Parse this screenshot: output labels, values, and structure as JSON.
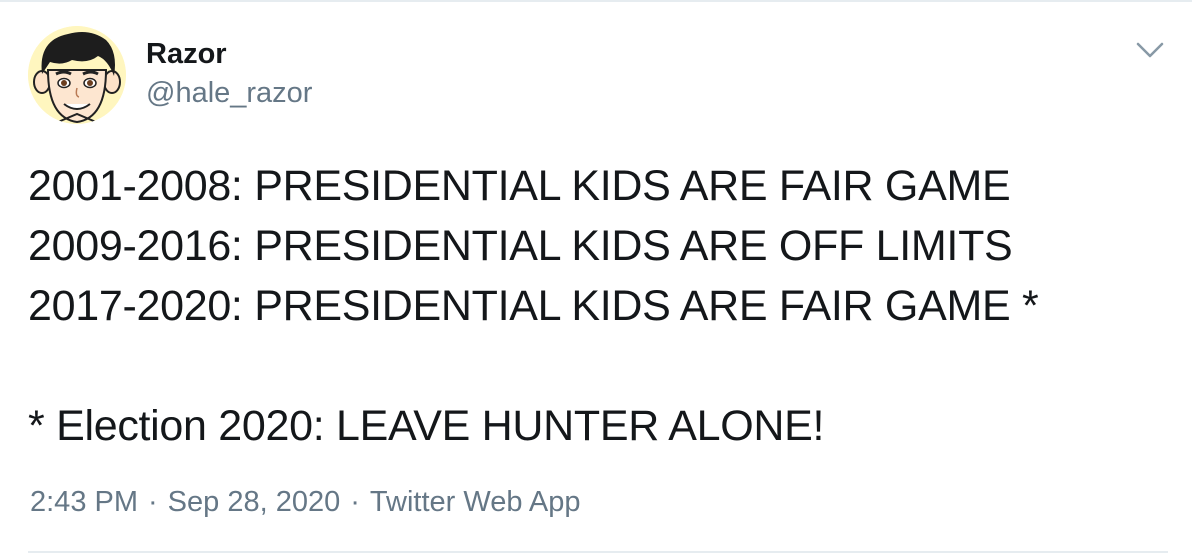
{
  "author": {
    "display_name": "Razor",
    "handle": "@hale_razor",
    "avatar_icon": "cartoon-face-avatar"
  },
  "menu": {
    "icon": "chevron-down-icon"
  },
  "tweet": {
    "lines": [
      "2001-2008: PRESIDENTIAL KIDS ARE FAIR GAME",
      "2009-2016: PRESIDENTIAL KIDS ARE OFF LIMITS",
      "2017-2020: PRESIDENTIAL KIDS ARE FAIR GAME *",
      "",
      "* Election 2020: LEAVE HUNTER ALONE!"
    ]
  },
  "meta": {
    "time": "2:43 PM",
    "date": "Sep 28, 2020",
    "source": "Twitter Web App",
    "separator": "·"
  },
  "colors": {
    "text_primary": "#14171a",
    "text_secondary": "#657786",
    "border": "#e6ecf0"
  }
}
